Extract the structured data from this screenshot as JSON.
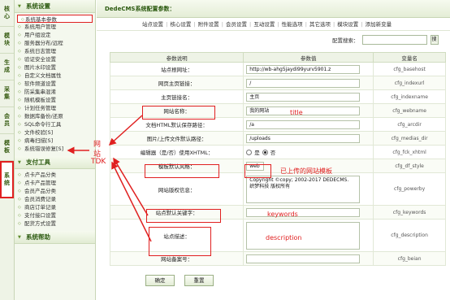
{
  "vtabs": [
    {
      "l1": "核",
      "l2": "心"
    },
    {
      "l1": "模",
      "l2": "块"
    },
    {
      "l1": "生",
      "l2": "成"
    },
    {
      "l1": "采",
      "l2": "集"
    },
    {
      "l1": "会",
      "l2": "员"
    },
    {
      "l1": "模",
      "l2": "板"
    },
    {
      "l1": "系",
      "l2": "统"
    }
  ],
  "sidebar": {
    "group1": "系统设置",
    "items1": [
      "系统基本参数",
      "系统用户管理",
      "用户组设定",
      "服务器分布/远程",
      "系统日志管理",
      "验证安全设置",
      "图片水印设置",
      "自定义文档属性",
      "软件频道设置",
      "防采集串混淆",
      "随机模板设置",
      "计划任务管理",
      "数据库备份/还原",
      "SQL命令行工具",
      "文件校验[S]",
      "病毒扫描[S]",
      "系统错误修复[S]"
    ],
    "group2": "支付工具",
    "items2": [
      "点卡产品分类",
      "点卡产品管理",
      "会员产品分类",
      "会员消费记录",
      "商店订单记录",
      "支付接口设置",
      "配货方式设置"
    ],
    "group3": "系统帮助"
  },
  "header": {
    "title": "DedeCMS系统配置参数：",
    "tabs": [
      "站点设置",
      "核心设置",
      "附件设置",
      "会员设置",
      "互动设置",
      "性能选项",
      "其它选项",
      "模块设置",
      "添加新变量"
    ]
  },
  "search": {
    "label": "配置搜索：",
    "btn": "搜"
  },
  "table": {
    "headers": [
      "参数说明",
      "参数值",
      "变量名"
    ],
    "rows": [
      {
        "label": "站点根网址：",
        "value": "http://wb-ahg5jaydi99yurv5901.z",
        "var": "cfg_basehost"
      },
      {
        "label": "网页主页链接：",
        "value": "/",
        "var": "cfg_indexurl"
      },
      {
        "label": "主页链接名：",
        "value": "主页",
        "var": "cfg_indexname"
      },
      {
        "label": "网站名称：",
        "value": "我的网站",
        "var": "cfg_webname"
      },
      {
        "label": "文档HTML默认保存路径：",
        "value": "/a",
        "var": "cfg_arcdir"
      },
      {
        "label": "图片/上传文件默认路径：",
        "value": "/uploads",
        "var": "cfg_medias_dir"
      },
      {
        "label": "编辑器（是/否）使用XHTML：",
        "radio_yes": "是",
        "radio_no": "否",
        "var": "cfg_fck_xhtml"
      },
      {
        "label": "模板默认风格：",
        "value": "web",
        "var": "cfg_df_style"
      },
      {
        "label": "网站版权信息：",
        "value1": "Copyright ©copy; 2002-2017 DEDECMS.",
        "value2": "织梦科技 版权所有",
        "var": "cfg_powerby"
      },
      {
        "label": "站点默认关键字：",
        "value": "",
        "var": "cfg_keywords"
      },
      {
        "label": "站点描述：",
        "value": "",
        "var": "cfg_description"
      },
      {
        "label": "网站备案号：",
        "value": "",
        "var": "cfg_beian"
      }
    ]
  },
  "buttons": {
    "ok": "确定",
    "reset": "重置"
  },
  "annotations": {
    "title": "title",
    "template": "已上传的网站模板",
    "keywords": "keywords",
    "description": "description",
    "tdk_1": "网",
    "tdk_2": "站",
    "tdk_3": "TDK"
  },
  "colors": {
    "annotation": "#e02020",
    "accent": "#2c5a10"
  }
}
